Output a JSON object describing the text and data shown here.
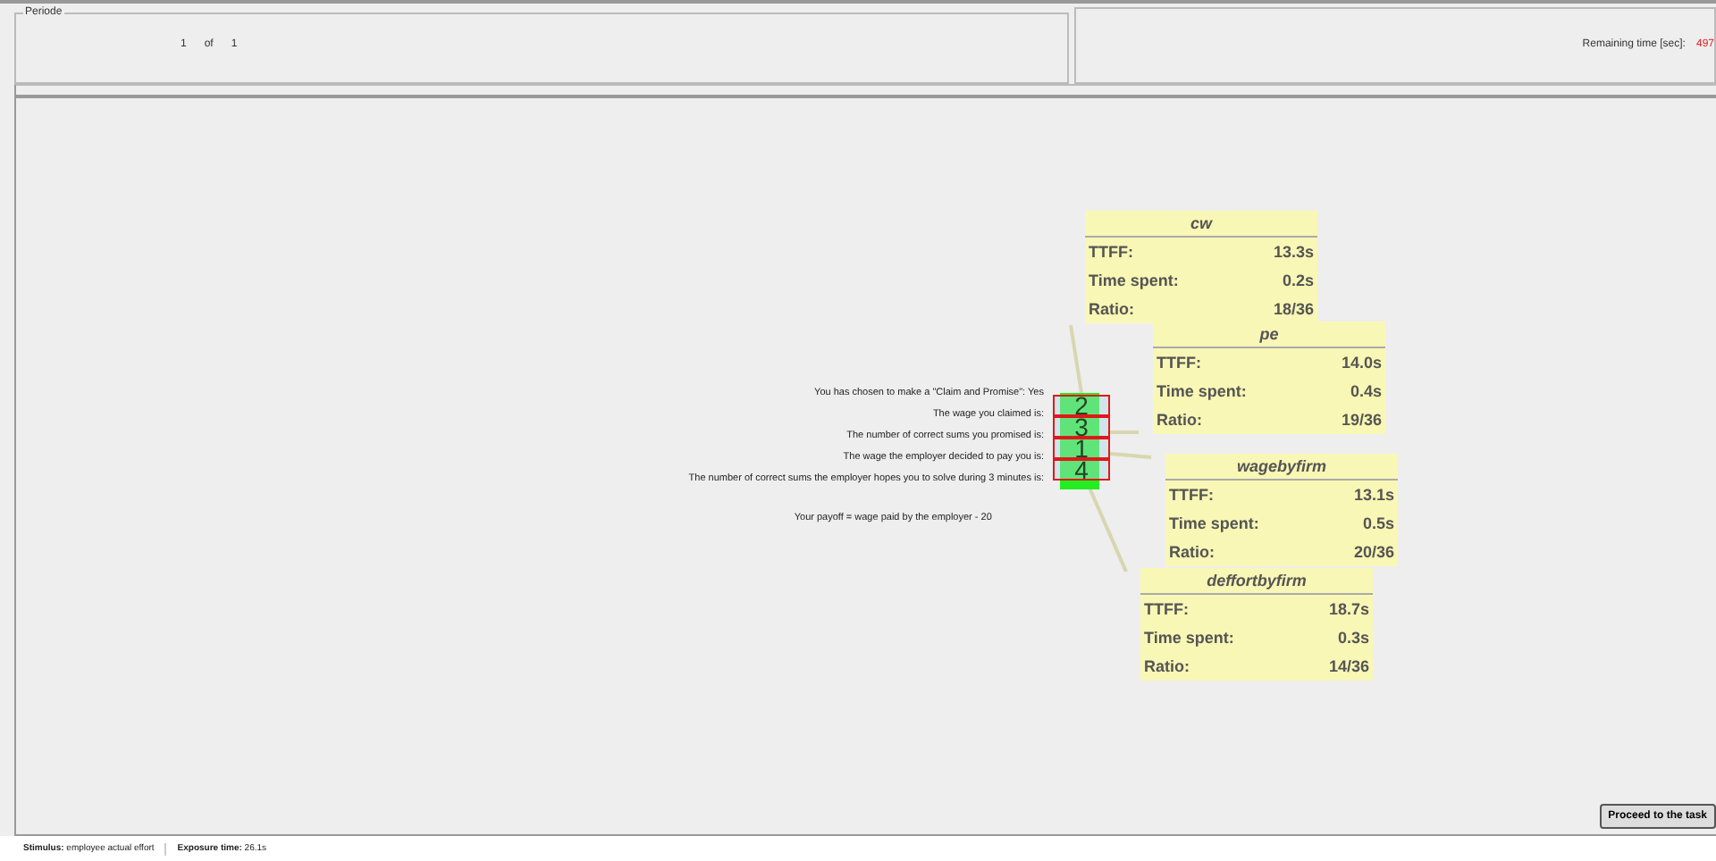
{
  "period": {
    "legend": "Periode",
    "current": "1",
    "of": "of",
    "total": "1"
  },
  "timer": {
    "label": "Remaining time [sec]:",
    "value": "497"
  },
  "statements": [
    "You has chosen to make a \"Claim and Promise\": Yes",
    "The wage you claimed is:",
    "The number of correct sums you promised is:",
    "The wage the employer decided to pay you is:",
    "The number of correct sums the employer hopes you to solve during 3 minutes is:"
  ],
  "answers": [
    "2",
    "3",
    "1",
    "4"
  ],
  "payoff": "Your payoff = wage paid by the employer - 20",
  "aoi_cards": [
    {
      "title": "cw",
      "rows": [
        {
          "label": "TTFF:",
          "value": "13.3s"
        },
        {
          "label": "Time spent:",
          "value": "0.2s"
        },
        {
          "label": "Ratio:",
          "value": "18/36"
        }
      ]
    },
    {
      "title": "pe",
      "rows": [
        {
          "label": "TTFF:",
          "value": "14.0s"
        },
        {
          "label": "Time spent:",
          "value": "0.4s"
        },
        {
          "label": "Ratio:",
          "value": "19/36"
        }
      ]
    },
    {
      "title": "wagebyfirm",
      "rows": [
        {
          "label": "TTFF:",
          "value": "13.1s"
        },
        {
          "label": "Time spent:",
          "value": "0.5s"
        },
        {
          "label": "Ratio:",
          "value": "20/36"
        }
      ]
    },
    {
      "title": "deffortbyfirm",
      "rows": [
        {
          "label": "TTFF:",
          "value": "18.7s"
        },
        {
          "label": "Time spent:",
          "value": "0.3s"
        },
        {
          "label": "Ratio:",
          "value": "14/36"
        }
      ]
    }
  ],
  "button": "Proceed to the task",
  "footer": {
    "stimulus": "**Stimulus:** employee actual effort",
    "exposure": "**Exposure time:** 26.1s"
  }
}
